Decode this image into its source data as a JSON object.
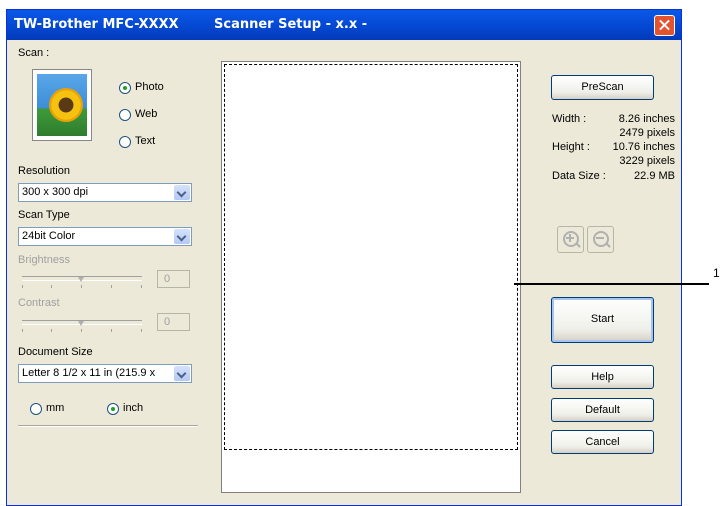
{
  "window": {
    "title_left": "TW-Brother MFC-XXXX",
    "title_right": "Scanner Setup - x.x -",
    "close_icon": "close-icon",
    "accent_color": "#0a58e8"
  },
  "scan": {
    "label": "Scan :",
    "options": [
      {
        "label": "Photo",
        "selected": true
      },
      {
        "label": "Web",
        "selected": false
      },
      {
        "label": "Text",
        "selected": false
      }
    ]
  },
  "resolution": {
    "label": "Resolution",
    "value": "300 x 300 dpi"
  },
  "scan_type": {
    "label": "Scan Type",
    "value": "24bit Color"
  },
  "brightness": {
    "label": "Brightness",
    "value": "0",
    "enabled": false
  },
  "contrast": {
    "label": "Contrast",
    "value": "0",
    "enabled": false
  },
  "document_size": {
    "label": "Document Size",
    "value": "Letter 8 1/2 x 11 in (215.9 x"
  },
  "units": [
    {
      "label": "mm",
      "selected": false
    },
    {
      "label": "inch",
      "selected": true
    }
  ],
  "info": {
    "prescan_label": "PreScan",
    "width_label": "Width :",
    "width_inches": "8.26 inches",
    "width_pixels": "2479 pixels",
    "height_label": "Height :",
    "height_inches": "10.76 inches",
    "height_pixels": "3229 pixels",
    "datasize_label": "Data Size :",
    "datasize_value": "22.9 MB"
  },
  "buttons": {
    "start": "Start",
    "help": "Help",
    "default": "Default",
    "cancel": "Cancel"
  },
  "callout_label": "1"
}
